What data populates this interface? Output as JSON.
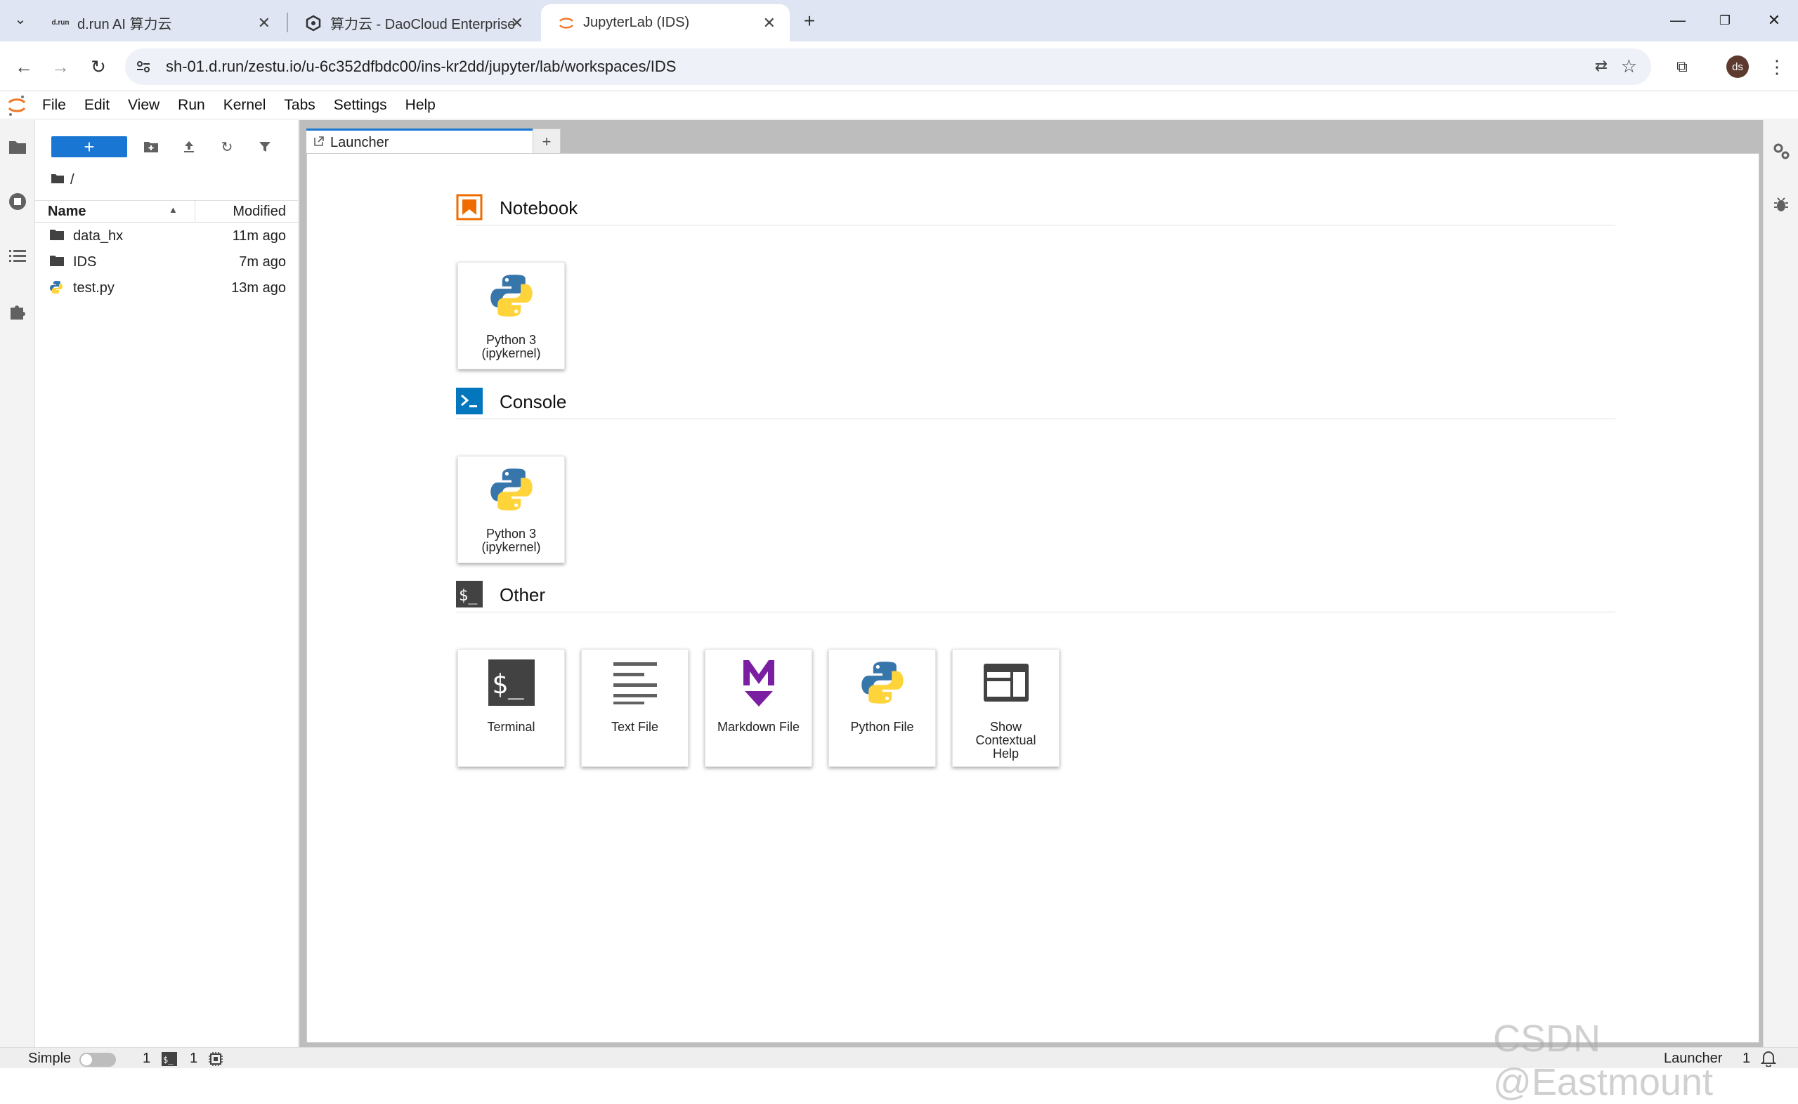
{
  "browser": {
    "tabs": [
      {
        "favicon": "d.run",
        "title": "d.run AI 算力云"
      },
      {
        "favicon": "daocloud-icon",
        "title": "算力云 - DaoCloud Enterprise"
      },
      {
        "favicon": "jupyter-icon",
        "title": "JupyterLab (IDS)"
      }
    ],
    "url": "sh-01.d.run/zestu.io/u-6c352dfbdc00/ins-kr2dd/jupyter/lab/workspaces/IDS",
    "profile_initials": "ds"
  },
  "menubar": {
    "items": [
      "File",
      "Edit",
      "View",
      "Run",
      "Kernel",
      "Tabs",
      "Settings",
      "Help"
    ]
  },
  "filebrowser": {
    "new_button": "+",
    "breadcrumb": "/",
    "columns": {
      "name": "Name",
      "modified": "Modified"
    },
    "files": [
      {
        "name": "data_hx",
        "modified": "11m ago",
        "type": "folder"
      },
      {
        "name": "IDS",
        "modified": "7m ago",
        "type": "folder"
      },
      {
        "name": "test.py",
        "modified": "13m ago",
        "type": "python"
      }
    ]
  },
  "dock": {
    "tab_label": "Launcher",
    "add_tab": "+"
  },
  "launcher": {
    "sections": {
      "notebook": {
        "title": "Notebook",
        "cards": [
          "Python 3\n(ipykernel)"
        ]
      },
      "console": {
        "title": "Console",
        "cards": [
          "Python 3\n(ipykernel)"
        ]
      },
      "other": {
        "title": "Other",
        "cards": [
          "Terminal",
          "Text File",
          "Markdown File",
          "Python File",
          "Show\nContextual\nHelp"
        ]
      }
    },
    "notebook_card": [
      "Python 3",
      "(ipykernel)"
    ],
    "console_card": [
      "Python 3",
      "(ipykernel)"
    ],
    "other_cards": {
      "terminal": "Terminal",
      "text_file": "Text File",
      "markdown_file": "Markdown File",
      "python_file": "Python File",
      "help": [
        "Show",
        "Contextual",
        "Help"
      ]
    }
  },
  "statusbar": {
    "mode": "Simple",
    "terminals": "1",
    "kernels": "1",
    "right_label": "Launcher",
    "right_count": "1"
  },
  "watermark": "CSDN @Eastmount"
}
